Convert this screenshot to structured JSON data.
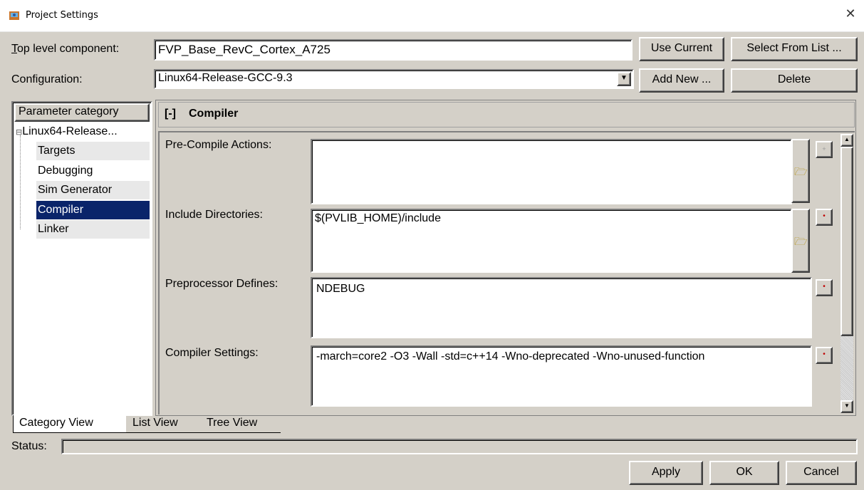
{
  "window": {
    "title": "Project Settings",
    "close_glyph": "✕",
    "icon": "app-icon"
  },
  "top_component": {
    "label": "Top level component:",
    "value": "FVP_Base_RevC_Cortex_A725",
    "use_current": "Use Current",
    "select_from_list": "Select From List ..."
  },
  "configuration": {
    "label": "Configuration:",
    "value": "Linux64-Release-GCC-9.3",
    "add_new": "Add New ...",
    "delete": "Delete"
  },
  "tree": {
    "header": "Parameter category",
    "root": "Linux64-Release...",
    "items": [
      "Targets",
      "Debugging",
      "Sim Generator",
      "Compiler",
      "Linker"
    ],
    "selected": "Compiler"
  },
  "section": {
    "toggle": "[-]",
    "title": "Compiler"
  },
  "params": {
    "pre_compile": {
      "label": "Pre-Compile Actions:",
      "value": ""
    },
    "include_dirs": {
      "label": "Include Directories:",
      "value": "$(PVLIB_HOME)/include"
    },
    "preproc_defines": {
      "label": "Preprocessor Defines:",
      "value": "NDEBUG"
    },
    "compiler_settings": {
      "label": "Compiler Settings:",
      "value": "-march=core2 -O3 -Wall -std=c++14 -Wno-deprecated -Wno-unused-function"
    }
  },
  "tabs": [
    "Category View",
    "List View",
    "Tree View"
  ],
  "status": {
    "label": "Status:",
    "value": ""
  },
  "buttons": {
    "apply": "Apply",
    "ok": "OK",
    "cancel": "Cancel"
  },
  "colors": {
    "selection": "#0a246a",
    "face": "#d4d0c8"
  }
}
